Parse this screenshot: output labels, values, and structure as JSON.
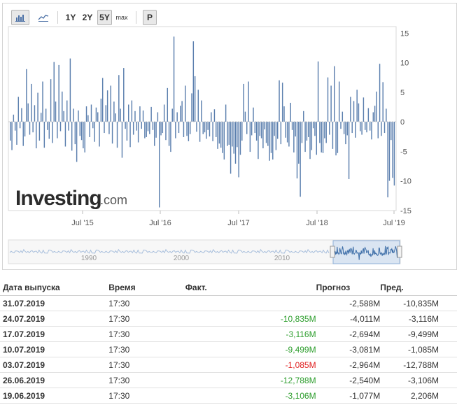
{
  "toolbar": {
    "bar_icon": "bar-chart-icon",
    "line_icon": "line-chart-icon",
    "ranges": [
      "1Y",
      "2Y",
      "5Y",
      "max"
    ],
    "active_range": "5Y",
    "p_label": "P"
  },
  "watermark": {
    "brand": "Investing",
    "suffix": ".com"
  },
  "chart_data": {
    "type": "bar",
    "y_ticks": [
      15,
      10,
      5,
      0,
      -5,
      -10,
      -15
    ],
    "x_tick_labels": [
      "Jul '15",
      "Jul '16",
      "Jul '17",
      "Jul '18",
      "Jul '19"
    ],
    "ylim": [
      -15,
      15
    ],
    "grid": false,
    "bar_color": "#5b7fae",
    "values": [
      -3.2,
      -4.8,
      1.2,
      -1.5,
      -3.9,
      4.2,
      -1.1,
      2.3,
      -4.1,
      -2.5,
      8.9,
      3.1,
      -2.2,
      6.4,
      -1.8,
      2.8,
      -4.5,
      4.9,
      -3.2,
      1.5,
      6.8,
      -4.4,
      2.2,
      -1.4,
      -2.9,
      7.2,
      -3.6,
      10.1,
      3.4,
      -2.8,
      9.6,
      -1.6,
      5.1,
      1.8,
      -4.2,
      3.6,
      -1.5,
      10.7,
      -4.9,
      2.2,
      -3.8,
      -6.8,
      1.9,
      -2.4,
      -3.1,
      -4.5,
      -5.2,
      2.6,
      1.1,
      -2.6,
      2.9,
      -1.1,
      -3.4,
      2.4,
      1.6,
      -4.2,
      3.9,
      7.4,
      -1.9,
      2.8,
      5.3,
      -2.1,
      6.1,
      -3.7,
      3.4,
      1.4,
      -4.4,
      7.9,
      2.2,
      -6.1,
      9.1,
      -1.2,
      -3.2,
      2.9,
      -4.3,
      3.6,
      -2.2,
      1.8,
      -1.5,
      -3.5,
      2.6,
      -1.2,
      1.9,
      -2.8,
      -2.6,
      -1.6,
      -2.1,
      2.5,
      -1.4,
      -4.1,
      -2.7,
      1.6,
      -14.5,
      -2.3,
      -1.9,
      2.9,
      -3.1,
      5.7,
      -4.1,
      -5.1,
      2.2,
      14.4,
      -2.8,
      1.6,
      -1.9,
      2.7,
      3.5,
      -2.6,
      6.1,
      -2.4,
      -3.3,
      -2.1,
      4.8,
      13.6,
      7.7,
      -1.7,
      5.4,
      -3.4,
      3.6,
      -2.1,
      -1.8,
      -2.9,
      -1.4,
      -2.5,
      1.6,
      -3.3,
      2.1,
      -2.6,
      -4.6,
      -3.7,
      -4.4,
      -5.3,
      -6.4,
      2.9,
      -4.1,
      -3.9,
      -8.8,
      -4.2,
      -5.4,
      -7.1,
      -4.3,
      -9.4,
      -5.6,
      -3.2,
      6.4,
      1.7,
      -2.1,
      6.8,
      -5.1,
      -2.3,
      2.4,
      -1.9,
      -3.2,
      -6.3,
      -2.4,
      -2.8,
      -4.5,
      -1.3,
      -3.6,
      -4.1,
      -6.6,
      -5.3,
      -6.4,
      -2.4,
      -4.8,
      -2.9,
      7.0,
      -3.8,
      6.6,
      2.6,
      -2.7,
      -3.5,
      -4.2,
      3.2,
      -1.4,
      -5.2,
      -2.5,
      -9.6,
      -7.1,
      -12.7,
      -3.6,
      1.8,
      -5.1,
      -3.2,
      -2.6,
      -6.3,
      -4.8,
      -1.1,
      -2.4,
      -5.6,
      10.2,
      -3.6,
      -5.2,
      -5.3,
      -2.8,
      -3.6,
      7.5,
      -2.2,
      6.1,
      -4.6,
      9.4,
      -5.7,
      -5.3,
      6.8,
      -1.2,
      1.7,
      -2.1,
      -3.8,
      -2.3,
      -9.7,
      4.2,
      -1.9,
      3.5,
      -2.7,
      5.4,
      3.1,
      -1.6,
      -2.2,
      4.1,
      -1.4,
      -1.8,
      2.3,
      -1.5,
      -3.0,
      1.6,
      2.7,
      5.1,
      -2.8,
      9.8,
      -2.4,
      6.7,
      -1.9,
      2.2,
      -12.8,
      -10.0,
      -3.1,
      -9.5,
      -10.8
    ]
  },
  "navigator": {
    "labels": [
      "1990",
      "2000",
      "2010"
    ]
  },
  "table": {
    "headers": {
      "date": "Дата выпуска",
      "time": "Время",
      "actual": "Факт.",
      "forecast": "Прогноз",
      "previous": "Пред."
    },
    "rows": [
      {
        "date": "31.07.2019",
        "time": "17:30",
        "actual": "",
        "forecast": "-2,588M",
        "previous": "-10,835M"
      },
      {
        "date": "24.07.2019",
        "time": "17:30",
        "actual": "-10,835M",
        "forecast": "-4,011M",
        "previous": "-3,116M"
      },
      {
        "date": "17.07.2019",
        "time": "17:30",
        "actual": "-3,116M",
        "forecast": "-2,694M",
        "previous": "-9,499M"
      },
      {
        "date": "10.07.2019",
        "time": "17:30",
        "actual": "-9,499M",
        "forecast": "-3,081M",
        "previous": "-1,085M"
      },
      {
        "date": "03.07.2019",
        "time": "17:30",
        "actual": "-1,085M",
        "forecast": "-2,964M",
        "previous": "-12,788M"
      },
      {
        "date": "26.06.2019",
        "time": "17:30",
        "actual": "-12,788M",
        "forecast": "-2,540M",
        "previous": "-3,106M"
      },
      {
        "date": "19.06.2019",
        "time": "17:30",
        "actual": "-3,106M",
        "forecast": "-1,077M",
        "previous": "2,206M"
      }
    ],
    "actual_colors": [
      "",
      "green",
      "green",
      "green",
      "red",
      "green",
      "green"
    ]
  }
}
